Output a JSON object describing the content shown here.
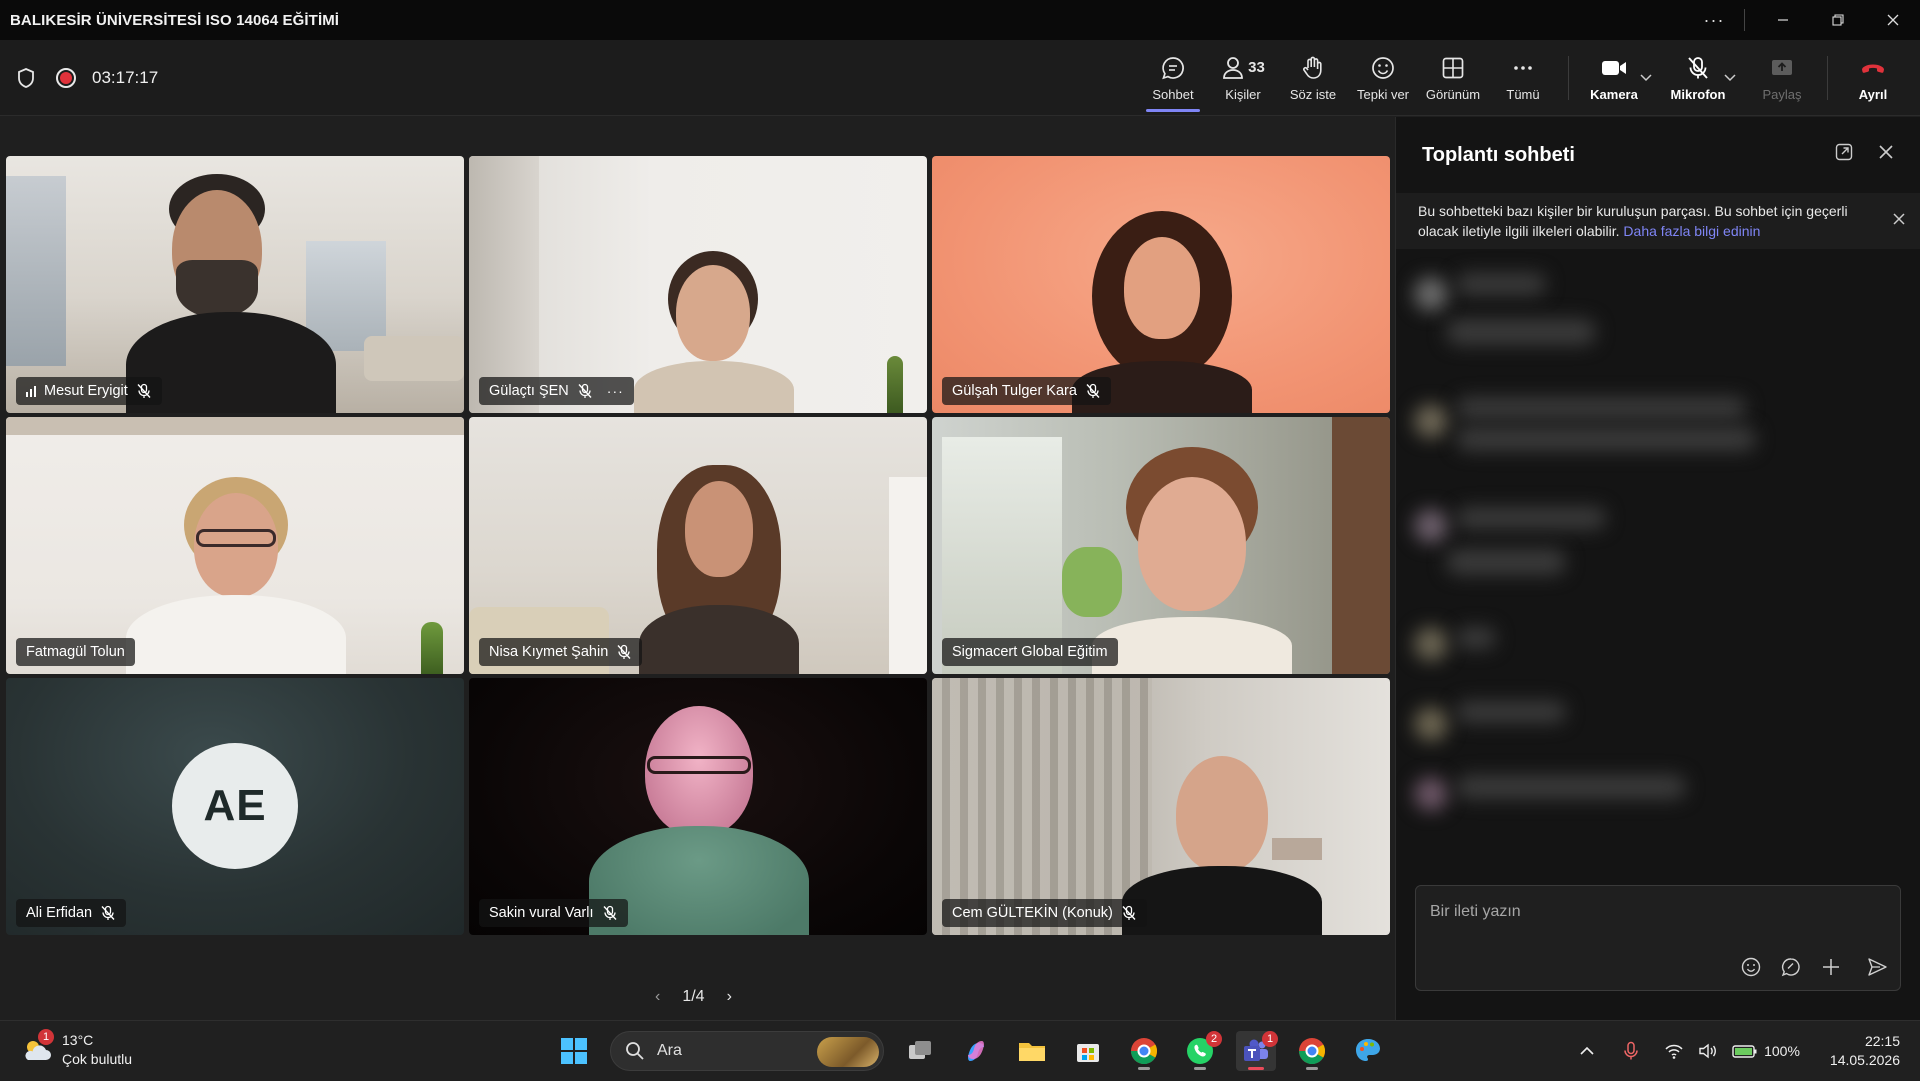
{
  "window": {
    "title": "BALIKESİR ÜNİVERSİTESİ ISO 14064 EĞİTİMİ",
    "more_label": "···",
    "minimize_label": "—",
    "restore_label": "❐",
    "close_label": "✕"
  },
  "meeting_bar": {
    "timer": "03:17:17",
    "participant_count": "33",
    "buttons": {
      "chat": "Sohbet",
      "people": "Kişiler",
      "raise_hand": "Söz iste",
      "react": "Tepki ver",
      "view": "Görünüm",
      "more": "Tümü",
      "camera": "Kamera",
      "mic": "Mikrofon",
      "share": "Paylaş",
      "leave": "Ayrıl"
    }
  },
  "participants": [
    {
      "name": "Mesut Eryigit",
      "muted": true,
      "signal": true
    },
    {
      "name": "Gülaçtı ŞEN",
      "muted": true,
      "more": "···"
    },
    {
      "name": "Gülşah Tulger Kara",
      "muted": true
    },
    {
      "name": "Fatmagül Tolun",
      "muted": false
    },
    {
      "name": "Nisa Kıymet Şahin",
      "muted": true
    },
    {
      "name": "Sigmacert Global Eğitim",
      "muted": false
    },
    {
      "name": "Ali Erfidan",
      "muted": true,
      "initials": "AE"
    },
    {
      "name": "Sakin vural Varlı",
      "muted": true
    },
    {
      "name": "Cem GÜLTEKİN (Konuk)",
      "muted": true
    }
  ],
  "pager": {
    "label": "1/4",
    "prev": "‹",
    "next": "›"
  },
  "chat": {
    "title": "Toplantı sohbeti",
    "notice_text": "Bu sohbetteki bazı kişiler bir kuruluşun parçası. Bu sohbet için geçerli olacak iletiyle ilgili ilkeleri olabilir.",
    "notice_link": "Daha fazla bilgi edinin",
    "composer_placeholder": "Bir ileti yazın"
  },
  "taskbar": {
    "weather_temp": "13°C",
    "weather_desc": "Çok bulutlu",
    "weather_badge": "1",
    "search_label": "Ara",
    "whatsapp_badge": "2",
    "teams_badge": "1",
    "battery": "100%",
    "time": "22:15",
    "date": "14.05.2026"
  },
  "colors": {
    "accent": "#7f85f5",
    "leave": "#e0323b",
    "badge": "#d13438"
  }
}
